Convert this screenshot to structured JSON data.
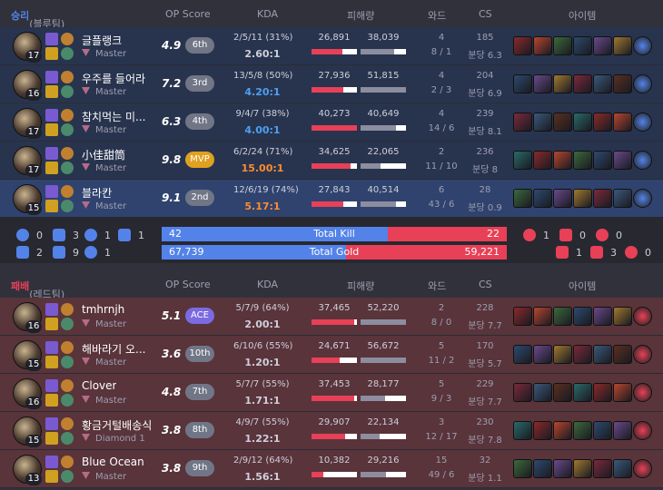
{
  "colors": {
    "blue_row": "#28344e",
    "blue_me": "#2f436e",
    "red_row": "#59343b",
    "win": "#5383e8",
    "loss": "#e84057",
    "mvp": "#e0a020",
    "ace": "#7b6ae0"
  },
  "win_team": {
    "result": "승리",
    "side": "(블루팀)",
    "headers": {
      "op": "OP Score",
      "kda": "KDA",
      "dmg": "피해량",
      "ward": "와드",
      "cs": "CS",
      "items": "아이템"
    },
    "players": [
      {
        "name": "글플랭크",
        "level": "17",
        "tier": "Master",
        "score": "4.9",
        "rank": "6th",
        "kda": "2/5/11 (31%)",
        "ratio": "2.60:1",
        "ratio_class": "",
        "dealt": "26,891",
        "taken": "38,039",
        "dealt_pct": 0.67,
        "taken_pct": 0.73,
        "ward": "4",
        "wards": "8 / 1",
        "cs": "185",
        "cspm": "분당 6.3",
        "me": false
      },
      {
        "name": "우주를 들어라",
        "level": "16",
        "tier": "Master",
        "score": "7.2",
        "rank": "3rd",
        "kda": "13/5/8 (50%)",
        "ratio": "4.20:1",
        "ratio_class": "good",
        "dealt": "27,936",
        "taken": "51,815",
        "dealt_pct": 0.69,
        "taken_pct": 1.0,
        "ward": "4",
        "wards": "2 / 3",
        "cs": "204",
        "cspm": "분당 6.9",
        "me": false
      },
      {
        "name": "참치먹는 미...",
        "level": "17",
        "tier": "Master",
        "score": "6.3",
        "rank": "4th",
        "kda": "9/4/7 (38%)",
        "ratio": "4.00:1",
        "ratio_class": "good",
        "dealt": "40,273",
        "taken": "40,649",
        "dealt_pct": 1.0,
        "taken_pct": 0.78,
        "ward": "4",
        "wards": "14 / 6",
        "cs": "239",
        "cspm": "분당 8.1",
        "me": false
      },
      {
        "name": "小佳甜筒",
        "level": "17",
        "tier": "Master",
        "score": "9.8",
        "rank": "MVP",
        "kda": "6/2/24 (71%)",
        "ratio": "15.00:1",
        "ratio_class": "great",
        "dealt": "34,625",
        "taken": "22,065",
        "dealt_pct": 0.86,
        "taken_pct": 0.43,
        "ward": "2",
        "wards": "11 / 10",
        "cs": "236",
        "cspm": "분당 8",
        "me": false
      },
      {
        "name": "블라칸",
        "level": "15",
        "tier": "Master",
        "score": "9.1",
        "rank": "2nd",
        "kda": "12/6/19 (74%)",
        "ratio": "5.17:1",
        "ratio_class": "great",
        "dealt": "27,843",
        "taken": "40,514",
        "dealt_pct": 0.69,
        "taken_pct": 0.78,
        "ward": "6",
        "wards": "43 / 6",
        "cs": "28",
        "cspm": "분당 0.9",
        "me": true
      }
    ]
  },
  "summary": {
    "blue_objectives": [
      "0",
      "3",
      "1",
      "1",
      "2",
      "9",
      "1"
    ],
    "red_objectives": [
      "1",
      "0",
      "0",
      "1",
      "3",
      "0"
    ],
    "kill_label": "Total Kill",
    "blue_kills": "42",
    "red_kills": "22",
    "kill_ratio": 0.656,
    "gold_label": "Total Gold",
    "blue_gold": "67,739",
    "red_gold": "59,221",
    "gold_ratio": 0.534
  },
  "loss_team": {
    "result": "패배",
    "side": "(레드팀)",
    "headers": {
      "op": "OP Score",
      "kda": "KDA",
      "dmg": "피해량",
      "ward": "와드",
      "cs": "CS",
      "items": "아이템"
    },
    "players": [
      {
        "name": "tmhrnjh",
        "level": "16",
        "tier": "Master",
        "score": "5.1",
        "rank": "ACE",
        "kda": "5/7/9 (64%)",
        "ratio": "2.00:1",
        "ratio_class": "",
        "dealt": "37,465",
        "taken": "52,220",
        "dealt_pct": 0.93,
        "taken_pct": 1.0,
        "ward": "2",
        "wards": "8 / 0",
        "cs": "228",
        "cspm": "분당 7.7"
      },
      {
        "name": "해바라기 오...",
        "level": "15",
        "tier": "Master",
        "score": "3.6",
        "rank": "10th",
        "kda": "6/10/6 (55%)",
        "ratio": "1.20:1",
        "ratio_class": "",
        "dealt": "24,671",
        "taken": "56,672",
        "dealt_pct": 0.61,
        "taken_pct": 1.0,
        "ward": "5",
        "wards": "11 / 2",
        "cs": "170",
        "cspm": "분당 5.7"
      },
      {
        "name": "Clover",
        "level": "16",
        "tier": "Master",
        "score": "4.8",
        "rank": "7th",
        "kda": "5/7/7 (55%)",
        "ratio": "1.71:1",
        "ratio_class": "",
        "dealt": "37,453",
        "taken": "28,177",
        "dealt_pct": 0.93,
        "taken_pct": 0.54,
        "ward": "5",
        "wards": "9 / 3",
        "cs": "229",
        "cspm": "분당 7.7"
      },
      {
        "name": "황금거털배송식",
        "level": "15",
        "tier": "Diamond 1",
        "score": "3.8",
        "rank": "8th",
        "kda": "4/9/7 (55%)",
        "ratio": "1.22:1",
        "ratio_class": "",
        "dealt": "29,907",
        "taken": "22,134",
        "dealt_pct": 0.74,
        "taken_pct": 0.42,
        "ward": "3",
        "wards": "12 / 17",
        "cs": "230",
        "cspm": "분당 7.8"
      },
      {
        "name": "Blue Ocean",
        "level": "13",
        "tier": "Master",
        "score": "3.8",
        "rank": "9th",
        "kda": "2/9/12 (64%)",
        "ratio": "1.56:1",
        "ratio_class": "",
        "dealt": "10,382",
        "taken": "29,216",
        "dealt_pct": 0.26,
        "taken_pct": 0.56,
        "ward": "15",
        "wards": "49 / 6",
        "cs": "32",
        "cspm": "분당 1.1"
      }
    ]
  }
}
